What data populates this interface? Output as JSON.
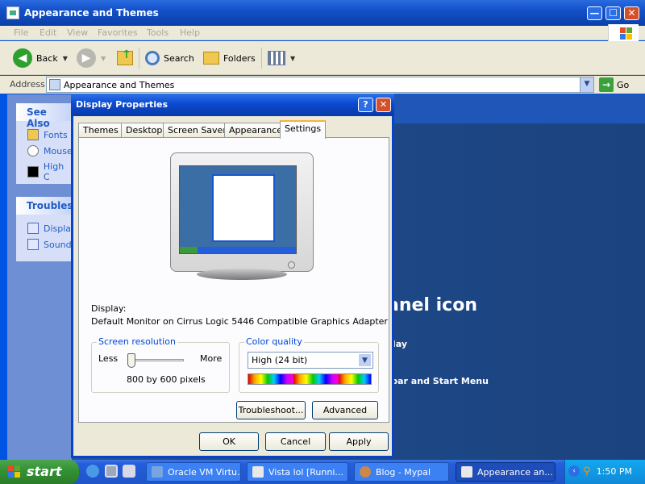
{
  "window": {
    "title": "Appearance and Themes",
    "min_label": "—",
    "max_label": "☐",
    "close_label": "✕"
  },
  "menu": [
    "File",
    "Edit",
    "View",
    "Favorites",
    "Tools",
    "Help"
  ],
  "toolbar": {
    "back_label": "Back",
    "search_label": "Search",
    "folders_label": "Folders"
  },
  "address": {
    "label": "Address",
    "value": "Appearance and Themes",
    "go_label": "Go"
  },
  "left_pane": {
    "see_also": {
      "title": "See Also",
      "items": [
        "Fonts",
        "Mouse",
        "High C"
      ]
    },
    "troubleshooters": {
      "title": "Troublesh",
      "items": [
        "Display",
        "Sound"
      ]
    }
  },
  "main": {
    "big_text": "anel icon",
    "line1": "lay",
    "line2": "tbar and Start Menu"
  },
  "dialog": {
    "title": "Display Properties",
    "help_label": "?",
    "close_label": "✕",
    "tabs": [
      "Themes",
      "Desktop",
      "Screen Saver",
      "Appearance",
      "Settings"
    ],
    "active_tab": "Settings",
    "display_label": "Display:",
    "display_value": "Default Monitor on Cirrus Logic 5446 Compatible Graphics Adapter",
    "screen_resolution": {
      "title": "Screen resolution",
      "less": "Less",
      "more": "More",
      "value": "800 by 600 pixels",
      "slider_level": 0
    },
    "color_quality": {
      "title": "Color quality",
      "selected": "High (24 bit)"
    },
    "troubleshoot_label": "Troubleshoot...",
    "advanced_label": "Advanced",
    "ok_label": "OK",
    "cancel_label": "Cancel",
    "apply_label": "Apply"
  },
  "taskbar": {
    "start_label": "start",
    "tasks": [
      "Oracle VM Virtu...",
      "Vista lol [Runni...",
      "Blog - Mypal",
      "Appearance an..."
    ],
    "clock": "1:50 PM"
  },
  "colors": {
    "xp_blue": "#0054e3",
    "start_green": "#339133",
    "tab_highlight": "#f7b33d"
  }
}
